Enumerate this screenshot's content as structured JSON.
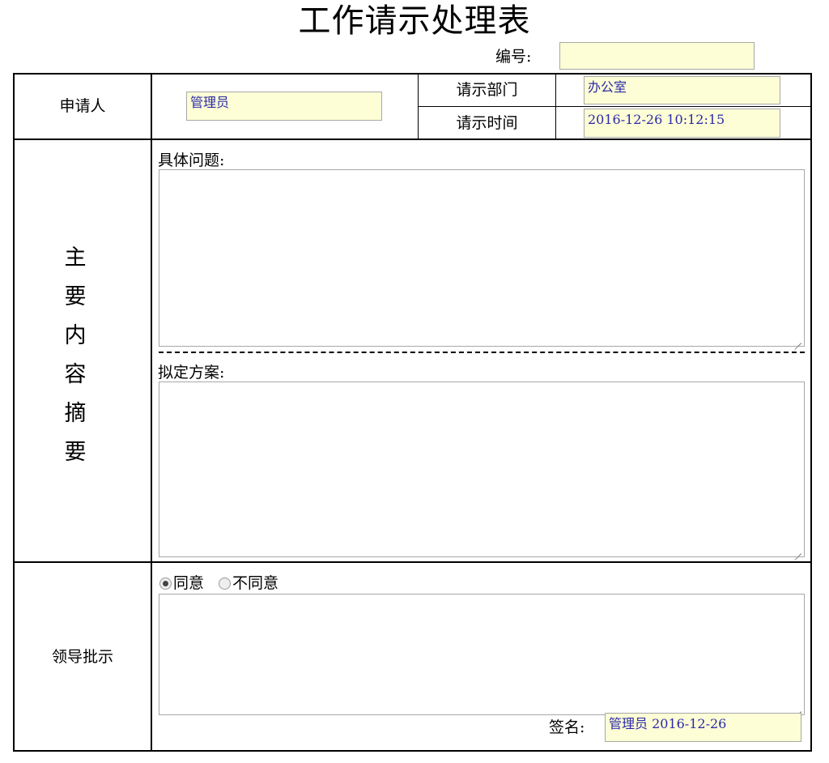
{
  "title": "工作请示处理表",
  "code": {
    "label": "编号:",
    "value": ""
  },
  "applicant": {
    "label": "申请人",
    "value": "管理员"
  },
  "department": {
    "label": "请示部门",
    "value": "办公室"
  },
  "request_time": {
    "label": "请示时间",
    "value": "2016-12-26 10:12:15"
  },
  "summary": {
    "label_chars": [
      "主",
      "要",
      "内",
      "容",
      "摘",
      "要"
    ],
    "problem_label": "具体问题:",
    "problem_value": "",
    "plan_label": "拟定方案:",
    "plan_value": ""
  },
  "leader": {
    "label": "领导批示",
    "options": [
      {
        "label": "同意",
        "checked": true
      },
      {
        "label": "不同意",
        "checked": false
      }
    ],
    "comment": "",
    "signature_label": "签名:",
    "signature_value": "管理员 2016-12-26"
  },
  "colors": {
    "field_bg": "#fdfdd6",
    "field_text": "#2a2aa8",
    "border": "#000000"
  }
}
